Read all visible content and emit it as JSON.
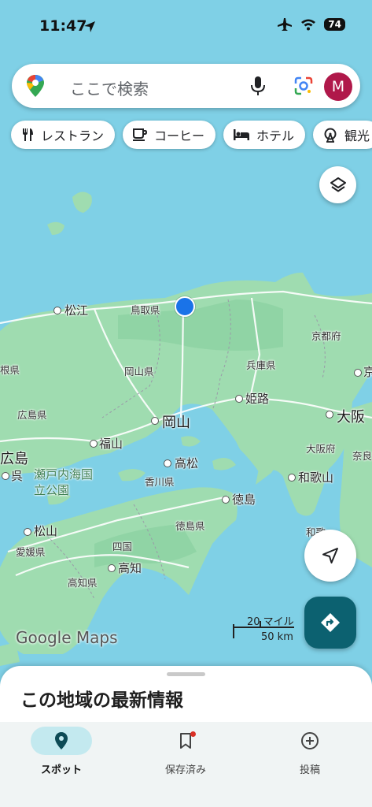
{
  "status": {
    "time": "11:47",
    "battery": "74"
  },
  "search": {
    "placeholder": "ここで検索",
    "avatar_letter": "M"
  },
  "chips": [
    {
      "label": "レストラン",
      "icon": "fork-knife-icon"
    },
    {
      "label": "コーヒー",
      "icon": "coffee-icon"
    },
    {
      "label": "ホテル",
      "icon": "bed-icon"
    },
    {
      "label": "観光",
      "icon": "ferris-wheel-icon"
    }
  ],
  "map": {
    "cities": {
      "matsue": "松江",
      "himeji": "姫路",
      "okayama": "岡山",
      "osaka": "大阪",
      "fukuyama": "福山",
      "hiroshima": "広島",
      "kure": "呉",
      "takamatsu": "高松",
      "tokushima": "徳島",
      "wakayama": "和歌山",
      "matsuyama": "松山",
      "kochi": "高知",
      "shikoku": "四国",
      "kyoto_partial": "京"
    },
    "prefectures": {
      "tottori": "鳥取県",
      "kyoto": "京都府",
      "shimane_partial": "根県",
      "okayama": "岡山県",
      "hyogo": "兵庫県",
      "hiroshima": "広島県",
      "osaka": "大阪府",
      "nara_partial": "奈良",
      "kagawa": "香川県",
      "tokushima": "徳島県",
      "ehime": "愛媛県",
      "kochi": "高知県",
      "wakayama_partial": "和歌"
    },
    "park": "瀬戸内海国立公園",
    "attribution": "Google Maps",
    "scale": {
      "miles": "20 マイル",
      "km": "50 km"
    }
  },
  "sheet": {
    "title": "この地域の最新情報"
  },
  "nav": [
    {
      "label": "スポット",
      "icon": "location-pin-icon",
      "active": true
    },
    {
      "label": "保存済み",
      "icon": "bookmark-icon",
      "active": false
    },
    {
      "label": "投稿",
      "icon": "add-circle-icon",
      "active": false
    }
  ],
  "colors": {
    "sea": "#7fd0e6",
    "land": "#9fdcb0",
    "accent": "#0c6170",
    "avatar": "#b0184a",
    "my_location": "#1a73e8"
  }
}
